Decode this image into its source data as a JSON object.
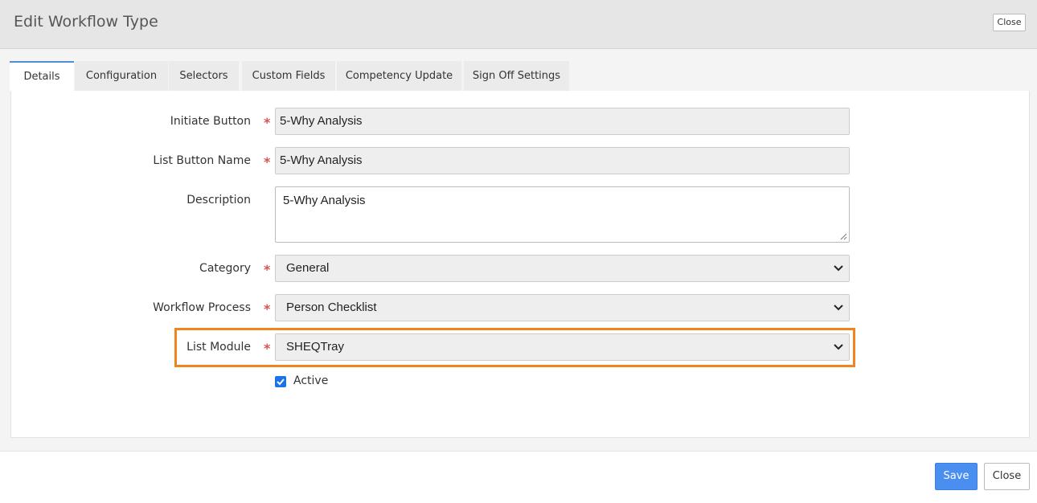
{
  "header": {
    "title": "Edit Workflow Type",
    "close_label": "Close"
  },
  "tabs": [
    {
      "label": "Details",
      "active": true
    },
    {
      "label": "Configuration"
    },
    {
      "label": "Selectors"
    },
    {
      "label": "Custom Fields"
    },
    {
      "label": "Competency Update"
    },
    {
      "label": "Sign Off Settings"
    }
  ],
  "form": {
    "initiate_button": {
      "label": "Initiate Button",
      "value": "5-Why Analysis",
      "required": true
    },
    "list_button_name": {
      "label": "List Button Name",
      "value": "5-Why Analysis",
      "required": true
    },
    "description": {
      "label": "Description",
      "value": "5-Why Analysis"
    },
    "category": {
      "label": "Category",
      "value": "General",
      "required": true
    },
    "workflow_process": {
      "label": "Workflow Process",
      "value": "Person Checklist",
      "required": true
    },
    "list_module": {
      "label": "List Module",
      "value": "SHEQTray",
      "required": true
    },
    "active": {
      "label": "Active",
      "checked": true
    },
    "required_marker": "*"
  },
  "footer": {
    "save_label": "Save",
    "close_label": "Close"
  },
  "colors": {
    "accent": "#4a8ff0",
    "highlight": "#f0851f",
    "required": "#d9534f"
  }
}
